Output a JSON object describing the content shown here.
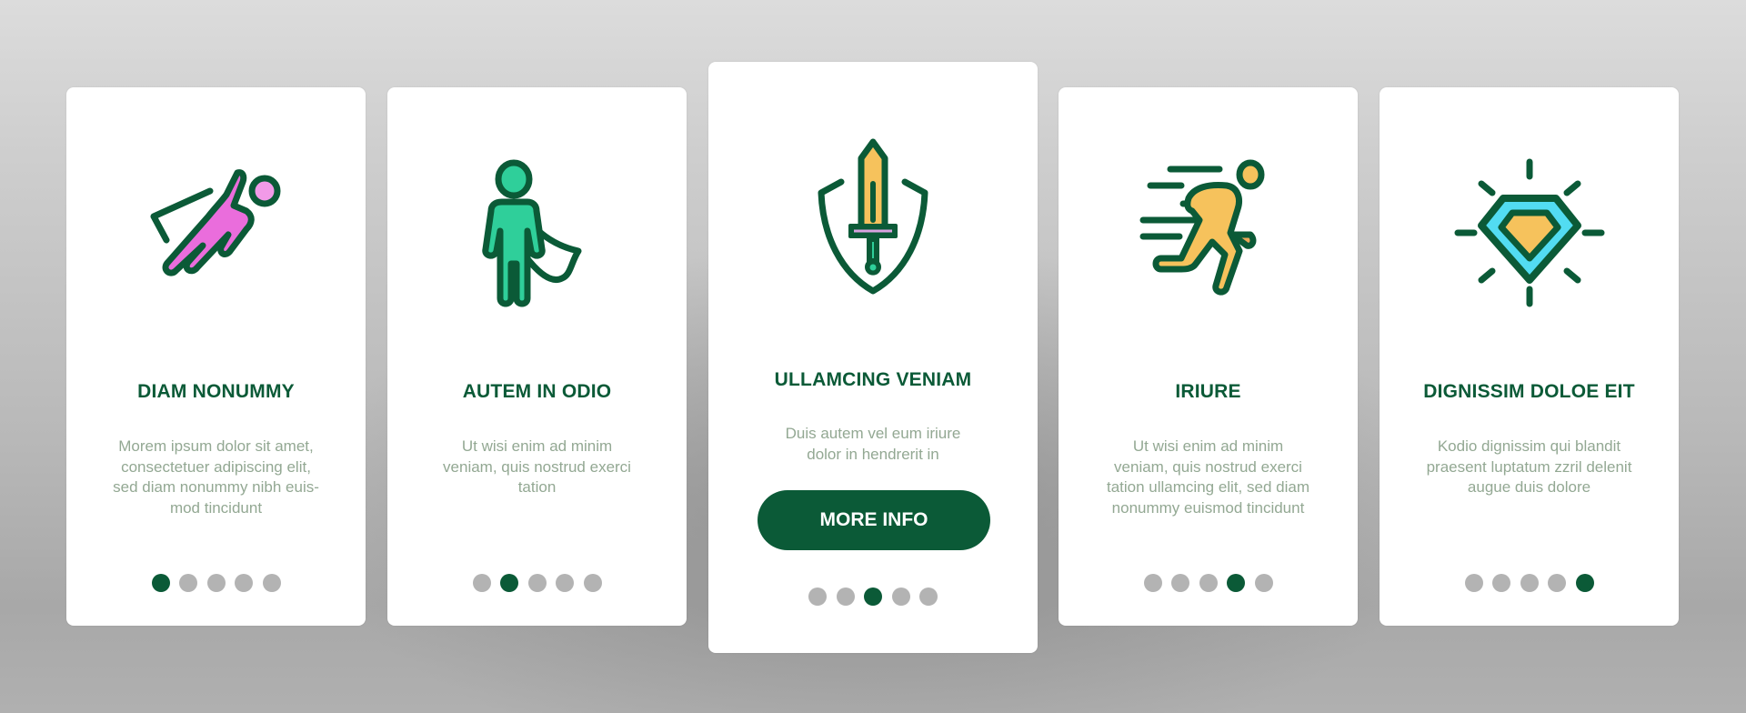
{
  "colors": {
    "primary": "#0b5a37",
    "body_text": "#93a893",
    "dot_inactive": "#b3b3b3",
    "dot_active": "#0b5a37",
    "card_bg": "#ffffff"
  },
  "cards": [
    {
      "icon": "flying-superhero-icon",
      "title": "DIAM NONUMMY",
      "body": [
        "Morem ipsum dolor sit amet,",
        "consectetuer adipiscing elit,",
        "sed diam nonummy nibh euis-",
        "mod tincidunt"
      ],
      "active_dot": 1,
      "total_dots": 5
    },
    {
      "icon": "caped-hero-icon",
      "title": "AUTEM IN ODIO",
      "body": [
        "Ut wisi enim ad minim",
        "veniam, quis nostrud exerci",
        "tation"
      ],
      "active_dot": 2,
      "total_dots": 5
    },
    {
      "icon": "sword-shield-icon",
      "title": "ULLAMCING VENIAM",
      "body": [
        "Duis autem vel eum iriure",
        "dolor in hendrerit in"
      ],
      "button_label": "MORE INFO",
      "active_dot": 3,
      "total_dots": 5
    },
    {
      "icon": "running-hero-icon",
      "title": "IRIURE",
      "body": [
        "Ut wisi enim ad minim",
        "veniam, quis nostrud exerci",
        "tation ullamcing elit, sed diam",
        "nonummy euismod tincidunt"
      ],
      "active_dot": 4,
      "total_dots": 5
    },
    {
      "icon": "shining-diamond-icon",
      "title": "DIGNISSIM DOLOE EIT",
      "body": [
        "Kodio dignissim qui blandit",
        "praesent luptatum zzril delenit",
        "augue duis dolore"
      ],
      "active_dot": 5,
      "total_dots": 5
    }
  ]
}
